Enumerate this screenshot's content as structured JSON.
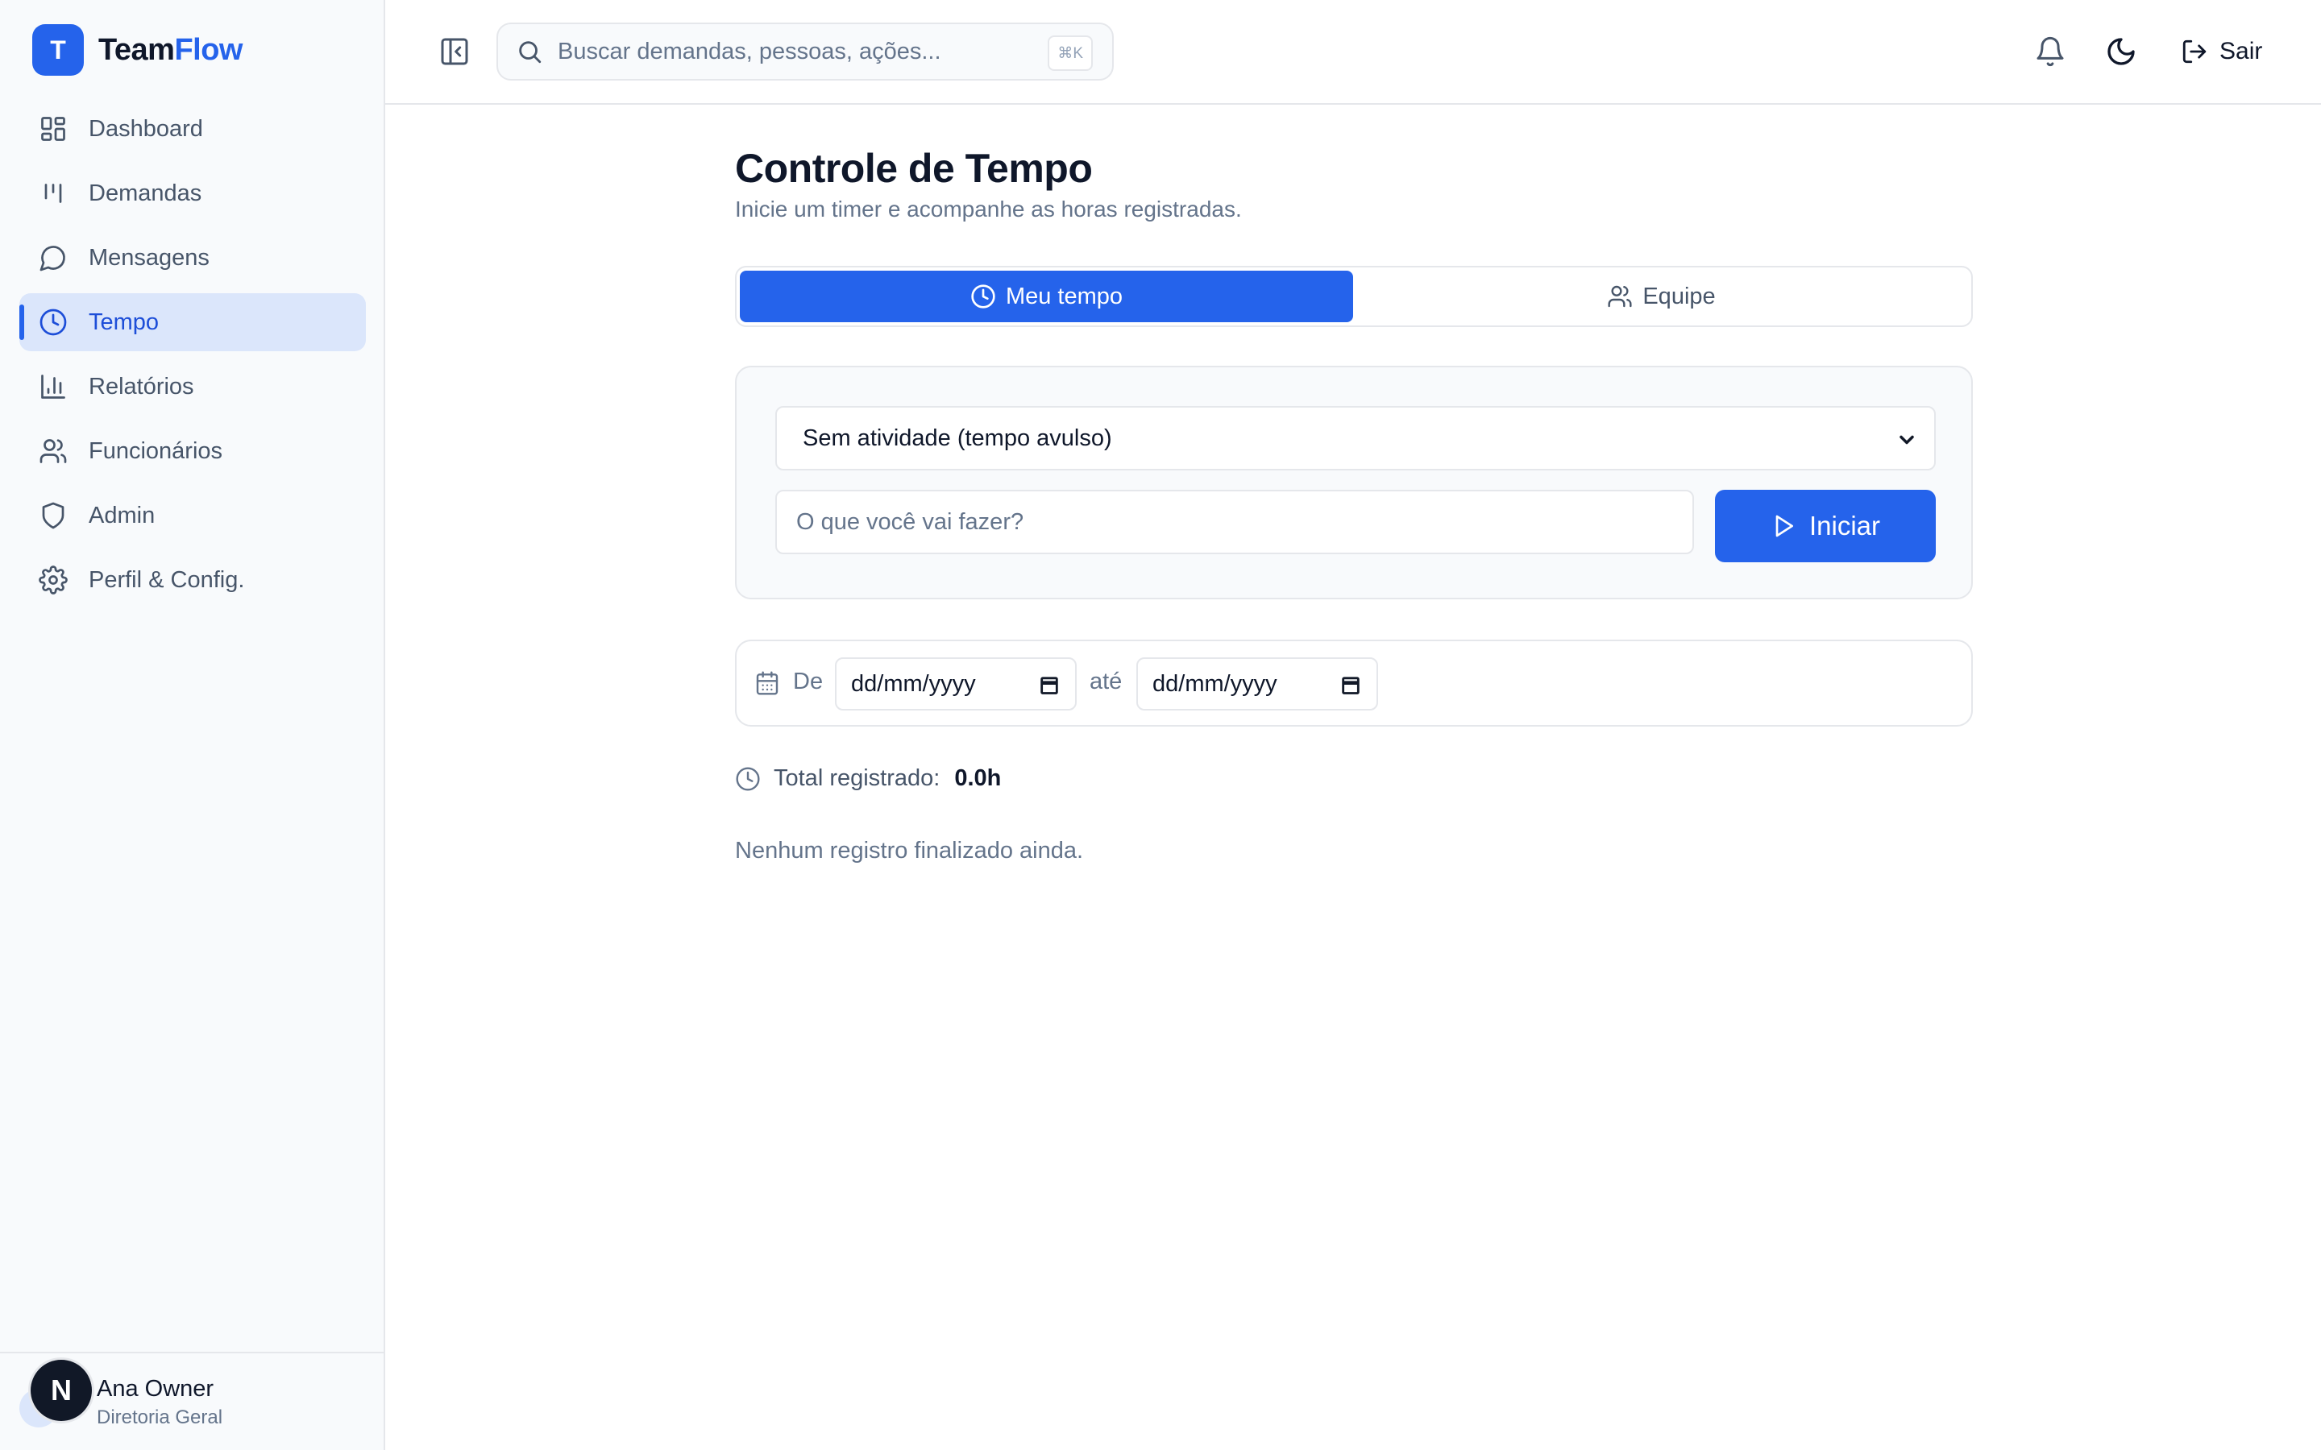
{
  "brand": {
    "logo_letter": "T",
    "name_part1": "Team",
    "name_part2": "Flow",
    "accent_color": "#2563eb"
  },
  "sidebar": {
    "items": [
      {
        "label": "Dashboard",
        "icon": "dashboard-icon",
        "active": false
      },
      {
        "label": "Demandas",
        "icon": "kanban-icon",
        "active": false
      },
      {
        "label": "Mensagens",
        "icon": "message-icon",
        "active": false
      },
      {
        "label": "Tempo",
        "icon": "clock-icon",
        "active": true
      },
      {
        "label": "Relatórios",
        "icon": "bar-chart-icon",
        "active": false
      },
      {
        "label": "Funcionários",
        "icon": "users-icon",
        "active": false
      },
      {
        "label": "Admin",
        "icon": "shield-icon",
        "active": false
      },
      {
        "label": "Perfil & Config.",
        "icon": "gear-icon",
        "active": false
      }
    ],
    "user": {
      "avatar_letter": "N",
      "name": "Ana Owner",
      "role": "Diretoria Geral"
    }
  },
  "header": {
    "search_placeholder": "Buscar demandas, pessoas, ações...",
    "search_shortcut": "⌘K",
    "logout_label": "Sair"
  },
  "main": {
    "title": "Controle de Tempo",
    "subtitle": "Inicie um timer e acompanhe as horas registradas.",
    "tabs": [
      {
        "label": "Meu tempo",
        "icon": "clock-icon",
        "active": true
      },
      {
        "label": "Equipe",
        "icon": "users-icon",
        "active": false
      }
    ],
    "timer": {
      "activity_selected": "Sem atividade (tempo avulso)",
      "task_placeholder": "O que você vai fazer?",
      "start_label": "Iniciar"
    },
    "filter": {
      "from_label": "De",
      "to_label": "até",
      "from_value": "dd/mm/yyyy",
      "to_value": "dd/mm/yyyy"
    },
    "total_label": "Total registrado:",
    "total_value": "0.0h",
    "empty_message": "Nenhum registro finalizado ainda."
  }
}
